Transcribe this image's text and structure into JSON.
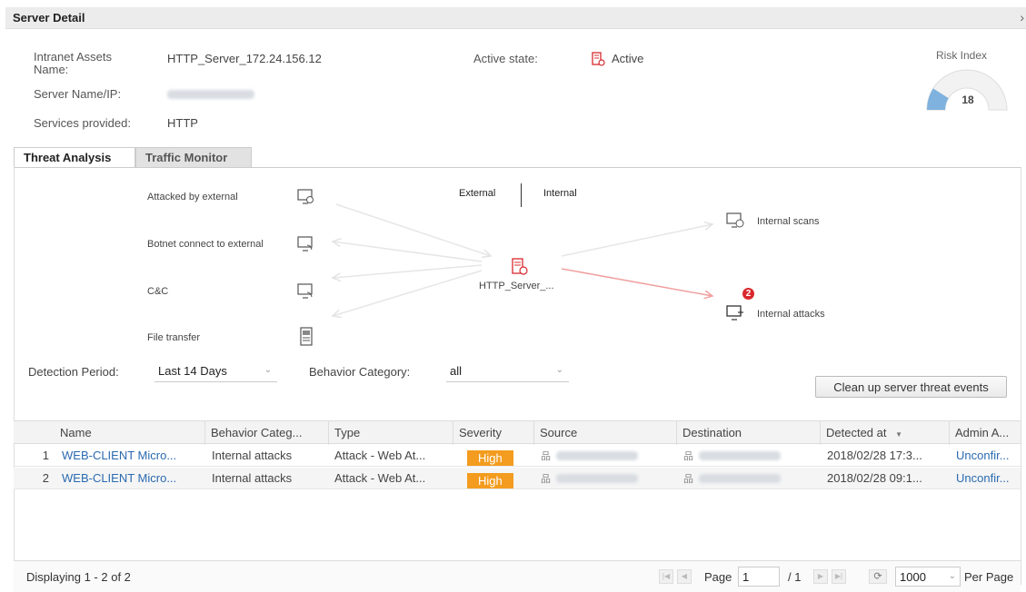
{
  "window": {
    "title": "Server Detail",
    "close_glyph": "›"
  },
  "info": {
    "intranet_label": "Intranet Assets Name:",
    "intranet_value": "HTTP_Server_172.24.156.12",
    "server_label": "Server Name/IP:",
    "services_label": "Services provided:",
    "services_value": "HTTP",
    "active_state_label": "Active state:",
    "active_state_value": "Active"
  },
  "risk": {
    "label": "Risk Index",
    "value": "18",
    "level": 18,
    "fill_color": "#7fb2de"
  },
  "tabs": [
    {
      "label": "Threat Analysis"
    },
    {
      "label": "Traffic Monitor"
    }
  ],
  "diagram": {
    "external_label": "External",
    "internal_label": "Internal",
    "center_label": "HTTP_Server_...",
    "left_items": [
      {
        "label": "Attacked by external",
        "icon": "monitor-attack-icon"
      },
      {
        "label": "Botnet connect to external",
        "icon": "monitor-botnet-icon"
      },
      {
        "label": "C&C",
        "icon": "monitor-cc-icon"
      },
      {
        "label": "File transfer",
        "icon": "file-icon"
      }
    ],
    "right_items": [
      {
        "label": "Internal scans",
        "icon": "monitor-scan-icon"
      },
      {
        "label": "Internal attacks",
        "icon": "monitor-attack-icon",
        "badge": "2"
      }
    ]
  },
  "filters": {
    "period_label": "Detection Period:",
    "period_value": "Last 14 Days",
    "category_label": "Behavior Category:",
    "category_value": "all",
    "cleanup_button": "Clean up server threat events"
  },
  "table": {
    "columns": [
      "Name",
      "Behavior Categ...",
      "Type",
      "Severity",
      "Source",
      "Destination",
      "Detected at",
      "Admin A..."
    ],
    "sort_indicator": "▼",
    "rows": [
      {
        "num": "1",
        "name": "WEB-CLIENT Micro...",
        "category": "Internal attacks",
        "type": "Attack - Web At...",
        "severity": "High",
        "detected": "2018/02/28 17:3...",
        "admin": "Unconfir..."
      },
      {
        "num": "2",
        "name": "WEB-CLIENT Micro...",
        "category": "Internal attacks",
        "type": "Attack - Web At...",
        "severity": "High",
        "detected": "2018/02/28 09:1...",
        "admin": "Unconfir..."
      }
    ]
  },
  "footer": {
    "displaying": "Displaying 1 - 2 of 2",
    "page_label": "Page",
    "page_value": "1",
    "page_total": "/ 1",
    "per_page_value": "1000",
    "per_page_label": "Per Page"
  },
  "colors": {
    "link": "#2a6ab0",
    "severity_high": "#f39c1f",
    "badge": "#d9282e",
    "alert_red": "#d9282e"
  }
}
